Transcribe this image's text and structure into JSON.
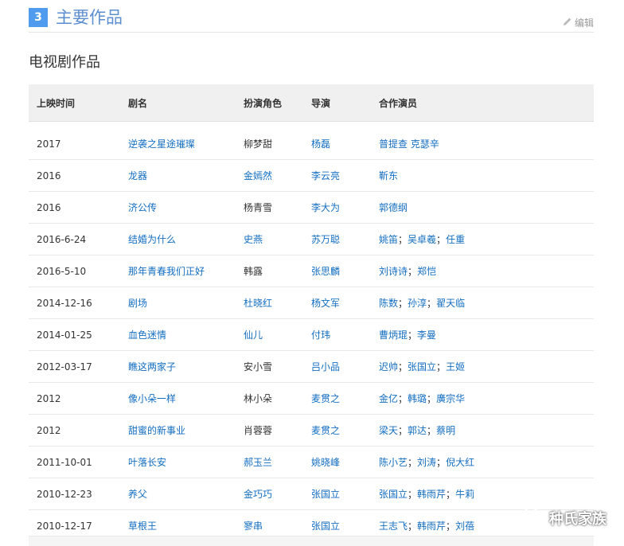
{
  "section": {
    "number": "3",
    "title": "主要作品",
    "edit_label": "编辑"
  },
  "subsection": {
    "title": "电视剧作品"
  },
  "table": {
    "headers": [
      "上映时间",
      "剧名",
      "扮演角色",
      "导演",
      "合作演员"
    ],
    "rows": [
      {
        "date": "2017",
        "title": "逆袭之星途璀璨",
        "role": "柳梦甜",
        "role_link": false,
        "director": "杨磊",
        "actors": [
          "普提查 克瑟辛"
        ]
      },
      {
        "date": "2016",
        "title": "龙器",
        "role": "金嫣然",
        "role_link": true,
        "director": "李云亮",
        "actors": [
          "靳东"
        ]
      },
      {
        "date": "2016",
        "title": "济公传",
        "role": "杨青雪",
        "role_link": false,
        "director": "李大为",
        "actors": [
          "郭德纲"
        ]
      },
      {
        "date": "2016-6-24",
        "title": "结婚为什么",
        "role": "史燕",
        "role_link": true,
        "director": "苏万聪",
        "actors": [
          "姚笛",
          "吴卓羲",
          "任重"
        ]
      },
      {
        "date": "2016-5-10",
        "title": "那年青春我们正好",
        "role": "韩露",
        "role_link": false,
        "director": "张思麟",
        "actors": [
          "刘诗诗",
          "郑恺"
        ]
      },
      {
        "date": "2014-12-16",
        "title": "剧场",
        "role": "杜晓红",
        "role_link": true,
        "director": "杨文军",
        "actors": [
          "陈数",
          "孙淳",
          "翟天临"
        ]
      },
      {
        "date": "2014-01-25",
        "title": "血色迷情",
        "role": "仙儿",
        "role_link": true,
        "director": "付玮",
        "actors": [
          "曹炳琨",
          "李曼"
        ]
      },
      {
        "date": "2012-03-17",
        "title": "瞧这两家子",
        "role": "安小雪",
        "role_link": false,
        "director": "吕小品",
        "actors": [
          "迟帅",
          "张国立",
          "王姬"
        ]
      },
      {
        "date": "2012",
        "title": "像小朵一样",
        "role": "林小朵",
        "role_link": false,
        "director": "麦贯之",
        "actors": [
          "金亿",
          "韩璐",
          "廣宗华"
        ]
      },
      {
        "date": "2012",
        "title": "甜蜜的新事业",
        "role": "肖蓉蓉",
        "role_link": false,
        "director": "麦贯之",
        "actors": [
          "梁天",
          "郭达",
          "蔡明"
        ]
      },
      {
        "date": "2011-10-01",
        "title": "叶落长安",
        "role": "郝玉兰",
        "role_link": true,
        "director": "姚晓峰",
        "actors": [
          "陈小艺",
          "刘涛",
          "倪大红"
        ]
      },
      {
        "date": "2010-12-23",
        "title": "养父",
        "role": "金巧巧",
        "role_link": true,
        "director": "张国立",
        "actors": [
          "张国立",
          "韩雨芹",
          "牛莉"
        ]
      },
      {
        "date": "2010-12-17",
        "title": "草根王",
        "role": "寥串",
        "role_link": true,
        "director": "张国立",
        "actors": [
          "王志飞",
          "韩雨芹",
          "刘蓓"
        ]
      }
    ],
    "actor_separator": "；"
  },
  "watermark": {
    "text": "种氏家族",
    "icon": "wechat-icon"
  },
  "colors": {
    "link": "#136ec2",
    "badge": "#4f9cee",
    "header_bg": "#f0f0f0"
  }
}
